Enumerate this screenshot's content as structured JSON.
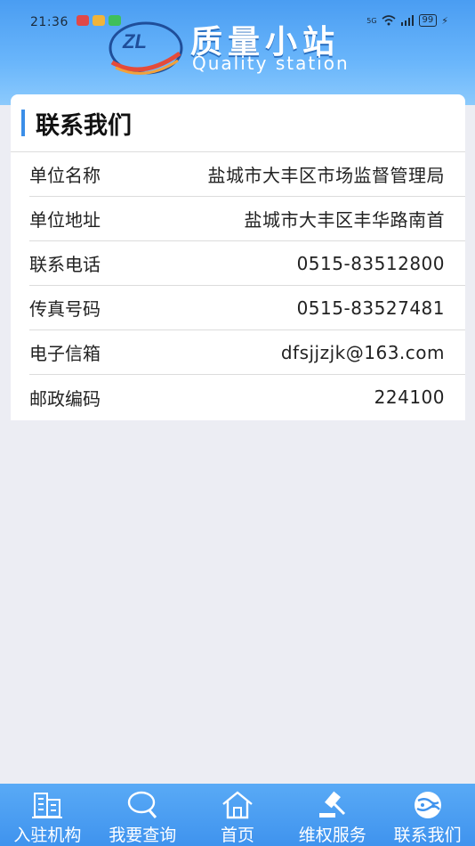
{
  "status_bar": {
    "time": "21:36",
    "battery": "99",
    "network": "5G"
  },
  "header": {
    "logo_text": "ZL",
    "title": "质量小站",
    "subtitle": "Quality station"
  },
  "contact": {
    "title": "联系我们",
    "rows": [
      {
        "label": "单位名称",
        "value": "盐城市大丰区市场监督管理局"
      },
      {
        "label": "单位地址",
        "value": "盐城市大丰区丰华路南首"
      },
      {
        "label": "联系电话",
        "value": "0515-83512800"
      },
      {
        "label": "传真号码",
        "value": "0515-83527481"
      },
      {
        "label": "电子信箱",
        "value": "dfsjjzjk@163.com"
      },
      {
        "label": "邮政编码",
        "value": "224100"
      }
    ]
  },
  "tabbar": {
    "items": [
      {
        "label": "入驻机构",
        "icon": "building-icon"
      },
      {
        "label": "我要查询",
        "icon": "search-icon"
      },
      {
        "label": "首页",
        "icon": "home-icon"
      },
      {
        "label": "维权服务",
        "icon": "gavel-icon"
      },
      {
        "label": "联系我们",
        "icon": "globe-icon"
      }
    ]
  },
  "colors": {
    "header": "#4a9df2",
    "tabbar": "#3f93ee",
    "accent_bar": "#3b8ee8",
    "background": "#ecedf3"
  }
}
